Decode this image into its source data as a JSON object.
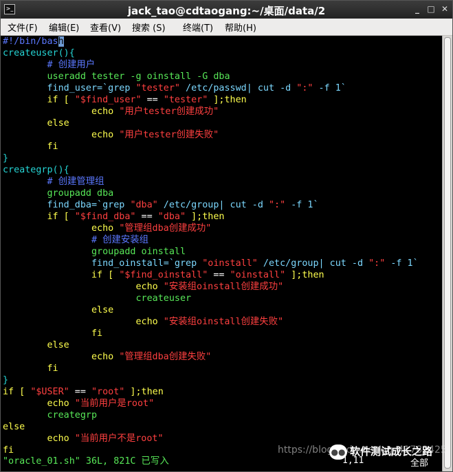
{
  "window": {
    "title": "jack_tao@cdtaogang:~/桌面/data/2",
    "minimize_glyph": "_",
    "maximize_glyph": "□",
    "close_glyph": "✕",
    "app_icon": "terminal-icon"
  },
  "menu": [
    {
      "label": "文件(F)"
    },
    {
      "label": "编辑(E)"
    },
    {
      "label": "查看(V)"
    },
    {
      "label": "搜索 (S)"
    },
    {
      "label": "终端(T)"
    },
    {
      "label": "帮助(H)"
    }
  ],
  "editor": {
    "lines": [
      [
        {
          "t": "#!/bin/bas",
          "c": "cmt"
        },
        {
          "t": "h",
          "c": "cursor"
        }
      ],
      [
        {
          "t": "createuser(){",
          "c": "fn"
        }
      ],
      [
        {
          "t": "        # 创建用户",
          "c": "cmt"
        }
      ],
      [
        {
          "t": "        useradd tester -g oinstall -G dba",
          "c": "type"
        }
      ],
      [
        {
          "t": "        find_user=`grep ",
          "c": "cmd"
        },
        {
          "t": "\"tester\"",
          "c": "str"
        },
        {
          "t": " /etc/passwd| cut -d ",
          "c": "cmd"
        },
        {
          "t": "\":\"",
          "c": "str"
        },
        {
          "t": " -f 1`",
          "c": "cmd"
        }
      ],
      [
        {
          "t": "        if [ ",
          "c": "kw"
        },
        {
          "t": "\"$find_user\"",
          "c": "str"
        },
        {
          "t": " == ",
          "c": "def"
        },
        {
          "t": "\"tester\"",
          "c": "str"
        },
        {
          "t": " ];then",
          "c": "kw"
        }
      ],
      [
        {
          "t": "                echo ",
          "c": "kw"
        },
        {
          "t": "\"用户tester创建成功\"",
          "c": "str"
        }
      ],
      [
        {
          "t": "        else",
          "c": "kw"
        }
      ],
      [
        {
          "t": "                echo ",
          "c": "kw"
        },
        {
          "t": "\"用户tester创建失败\"",
          "c": "str"
        }
      ],
      [
        {
          "t": "        fi",
          "c": "kw"
        }
      ],
      [
        {
          "t": "}",
          "c": "fn"
        }
      ],
      [
        {
          "t": "creategrp(){",
          "c": "fn"
        }
      ],
      [
        {
          "t": "        # 创建管理组",
          "c": "cmt"
        }
      ],
      [
        {
          "t": "        groupadd dba",
          "c": "type"
        }
      ],
      [
        {
          "t": "        find_dba=`grep ",
          "c": "cmd"
        },
        {
          "t": "\"dba\"",
          "c": "str"
        },
        {
          "t": " /etc/group| cut -d ",
          "c": "cmd"
        },
        {
          "t": "\":\"",
          "c": "str"
        },
        {
          "t": " -f 1`",
          "c": "cmd"
        }
      ],
      [
        {
          "t": "        if [ ",
          "c": "kw"
        },
        {
          "t": "\"$find_dba\"",
          "c": "str"
        },
        {
          "t": " == ",
          "c": "def"
        },
        {
          "t": "\"dba\"",
          "c": "str"
        },
        {
          "t": " ];then",
          "c": "kw"
        }
      ],
      [
        {
          "t": "                echo ",
          "c": "kw"
        },
        {
          "t": "\"管理组dba创建成功\"",
          "c": "str"
        }
      ],
      [
        {
          "t": "                # 创建安装组",
          "c": "cmt"
        }
      ],
      [
        {
          "t": "                groupadd oinstall",
          "c": "type"
        }
      ],
      [
        {
          "t": "                find_oinstall=`grep ",
          "c": "cmd"
        },
        {
          "t": "\"oinstall\"",
          "c": "str"
        },
        {
          "t": " /etc/group| cut -d ",
          "c": "cmd"
        },
        {
          "t": "\":\"",
          "c": "str"
        },
        {
          "t": " -f 1`",
          "c": "cmd"
        }
      ],
      [
        {
          "t": "                if [ ",
          "c": "kw"
        },
        {
          "t": "\"$find_oinstall\"",
          "c": "str"
        },
        {
          "t": " == ",
          "c": "def"
        },
        {
          "t": "\"oinstall\"",
          "c": "str"
        },
        {
          "t": " ];then",
          "c": "kw"
        }
      ],
      [
        {
          "t": "                        echo ",
          "c": "kw"
        },
        {
          "t": "\"安装组oinstall创建成功\"",
          "c": "str"
        }
      ],
      [
        {
          "t": "                        createuser",
          "c": "type"
        }
      ],
      [
        {
          "t": "                else",
          "c": "kw"
        }
      ],
      [
        {
          "t": "                        echo ",
          "c": "kw"
        },
        {
          "t": "\"安装组oinstall创建失败\"",
          "c": "str"
        }
      ],
      [
        {
          "t": "                fi",
          "c": "kw"
        }
      ],
      [
        {
          "t": "        else",
          "c": "kw"
        }
      ],
      [
        {
          "t": "                echo ",
          "c": "kw"
        },
        {
          "t": "\"管理组dba创建失败\"",
          "c": "str"
        }
      ],
      [
        {
          "t": "        fi",
          "c": "kw"
        }
      ],
      [
        {
          "t": "}",
          "c": "fn"
        }
      ],
      [
        {
          "t": "if [ ",
          "c": "kw"
        },
        {
          "t": "\"$USER\"",
          "c": "str"
        },
        {
          "t": " == ",
          "c": "def"
        },
        {
          "t": "\"root\"",
          "c": "str"
        },
        {
          "t": " ];then",
          "c": "kw"
        }
      ],
      [
        {
          "t": "        echo ",
          "c": "kw"
        },
        {
          "t": "\"当前用户是root\"",
          "c": "str"
        }
      ],
      [
        {
          "t": "        creategrp",
          "c": "type"
        }
      ],
      [
        {
          "t": "else",
          "c": "kw"
        }
      ],
      [
        {
          "t": "        echo ",
          "c": "kw"
        },
        {
          "t": "\"当前用户不是root\"",
          "c": "str"
        }
      ],
      [
        {
          "t": "fi",
          "c": "kw"
        }
      ]
    ],
    "status": "\"oracle_01.sh\" 36L, 821C 已写入",
    "position": "1,11",
    "position_scope": "全部"
  },
  "watermark": {
    "url": "https://blog.csdn.net/qq_41782425",
    "brand": "软件测试成长之路",
    "logo": "wechat-icon"
  }
}
